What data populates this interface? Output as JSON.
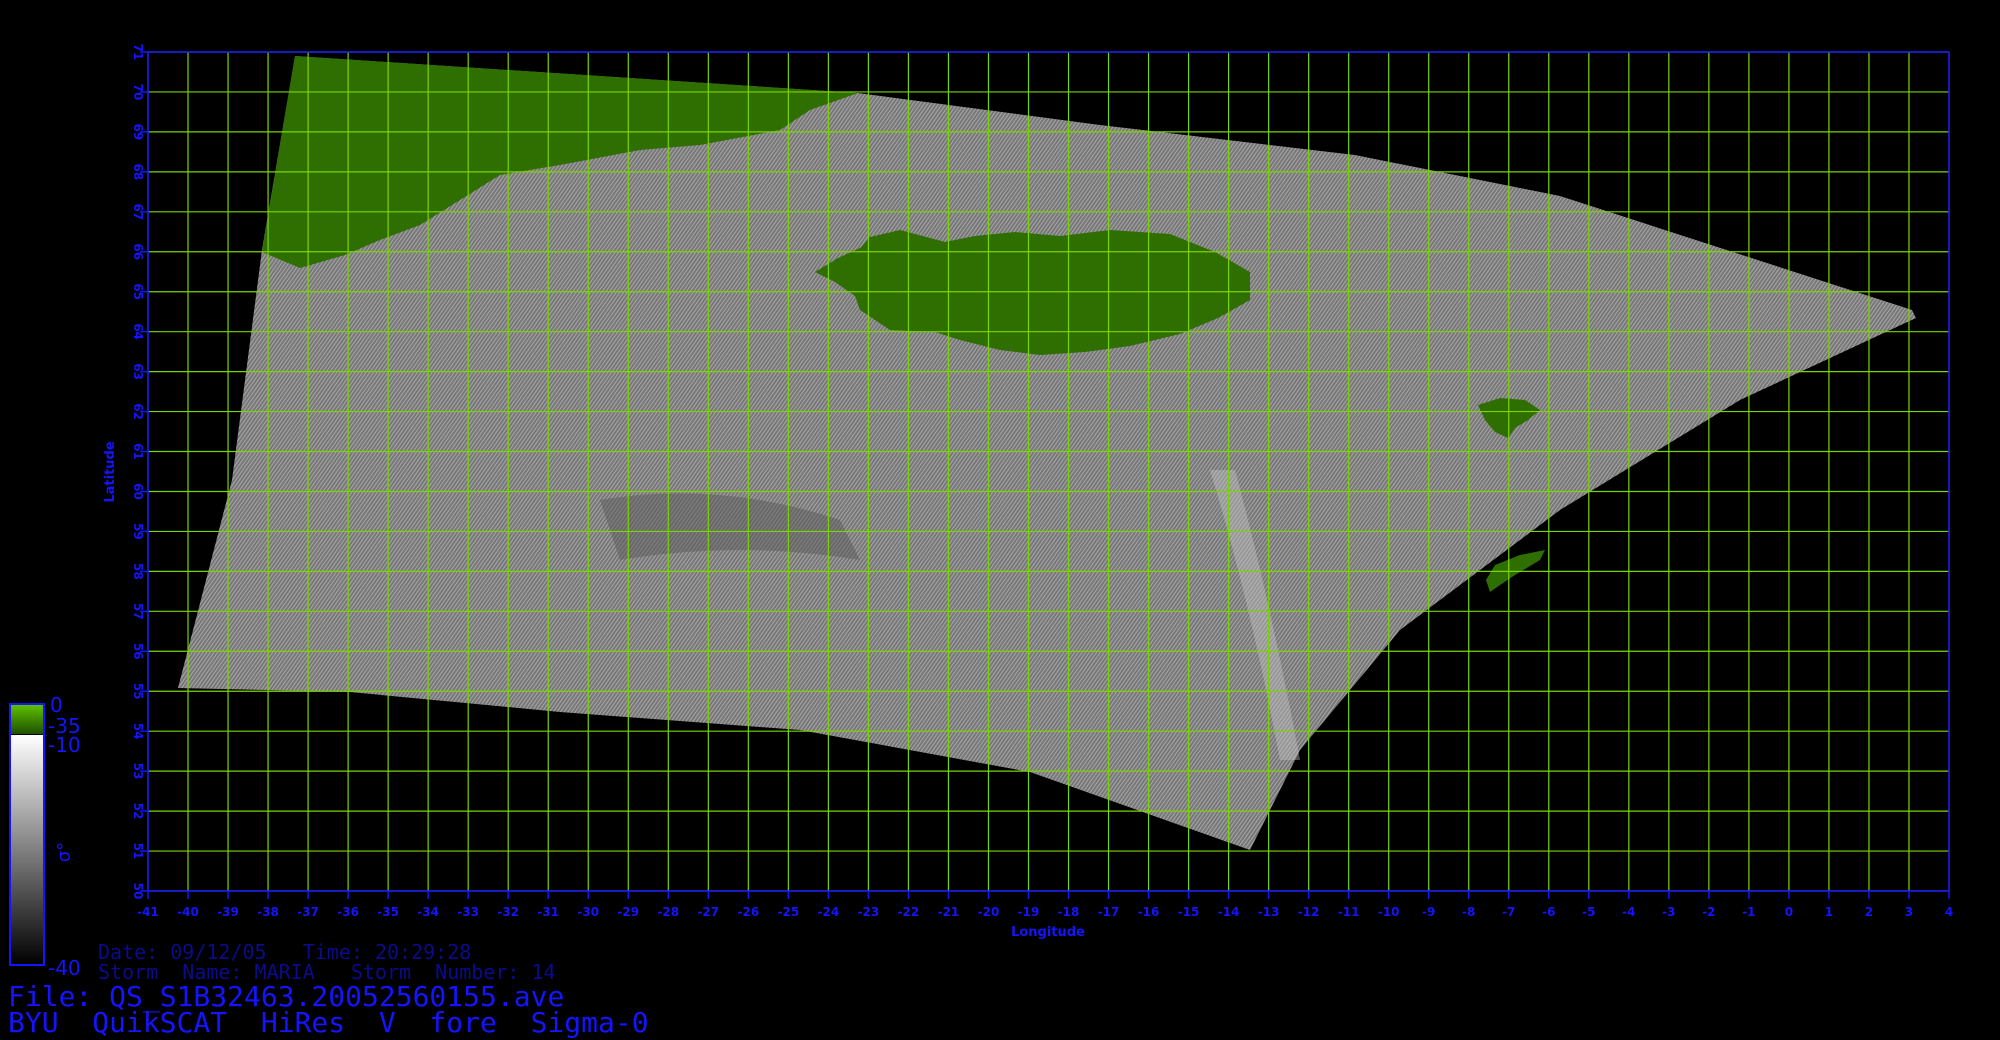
{
  "map": {
    "lon_ticks": [
      -41,
      -40,
      -39,
      -38,
      -37,
      -36,
      -35,
      -34,
      -33,
      -32,
      -31,
      -30,
      -29,
      -28,
      -27,
      -26,
      -25,
      -24,
      -23,
      -22,
      -21,
      -20,
      -19,
      -18,
      -17,
      -16,
      -15,
      -14,
      -13,
      -12,
      -11,
      -10,
      -9,
      -8,
      -7,
      -6,
      -5,
      -4,
      -3,
      -2,
      -1,
      0,
      1,
      2,
      3,
      4
    ],
    "lat_ticks": [
      50,
      51,
      52,
      53,
      54,
      55,
      56,
      57,
      58,
      59,
      60,
      61,
      62,
      63,
      64,
      65,
      66,
      67,
      68,
      69,
      70,
      71
    ],
    "lon_range": [
      -41,
      4
    ],
    "lat_range": [
      50,
      71
    ],
    "xlabel": "Longitude",
    "ylabel": "Latitude",
    "grid": true,
    "colors": {
      "frame": "#1414ff",
      "grid": "#7ad400",
      "land": "#2f6e00",
      "swath": "#8a8a8a",
      "background": "#000000",
      "text": "#1414ff"
    }
  },
  "colorbar": {
    "land_top_label": "0",
    "land_bottom_label": "-35",
    "swath_top_label": "-10",
    "swath_bottom_label": "-40",
    "symbol": "σ°"
  },
  "meta": {
    "date_line": "Date: 09/12/05   Time: 20:29:28",
    "storm_line": "Storm  Name: MARIA   Storm  Number: 14",
    "file_line": "File: QS_S1B32463.20052560155.ave",
    "title_line": "BYU  QuikSCAT  HiRes  V  fore  Sigma-0"
  }
}
